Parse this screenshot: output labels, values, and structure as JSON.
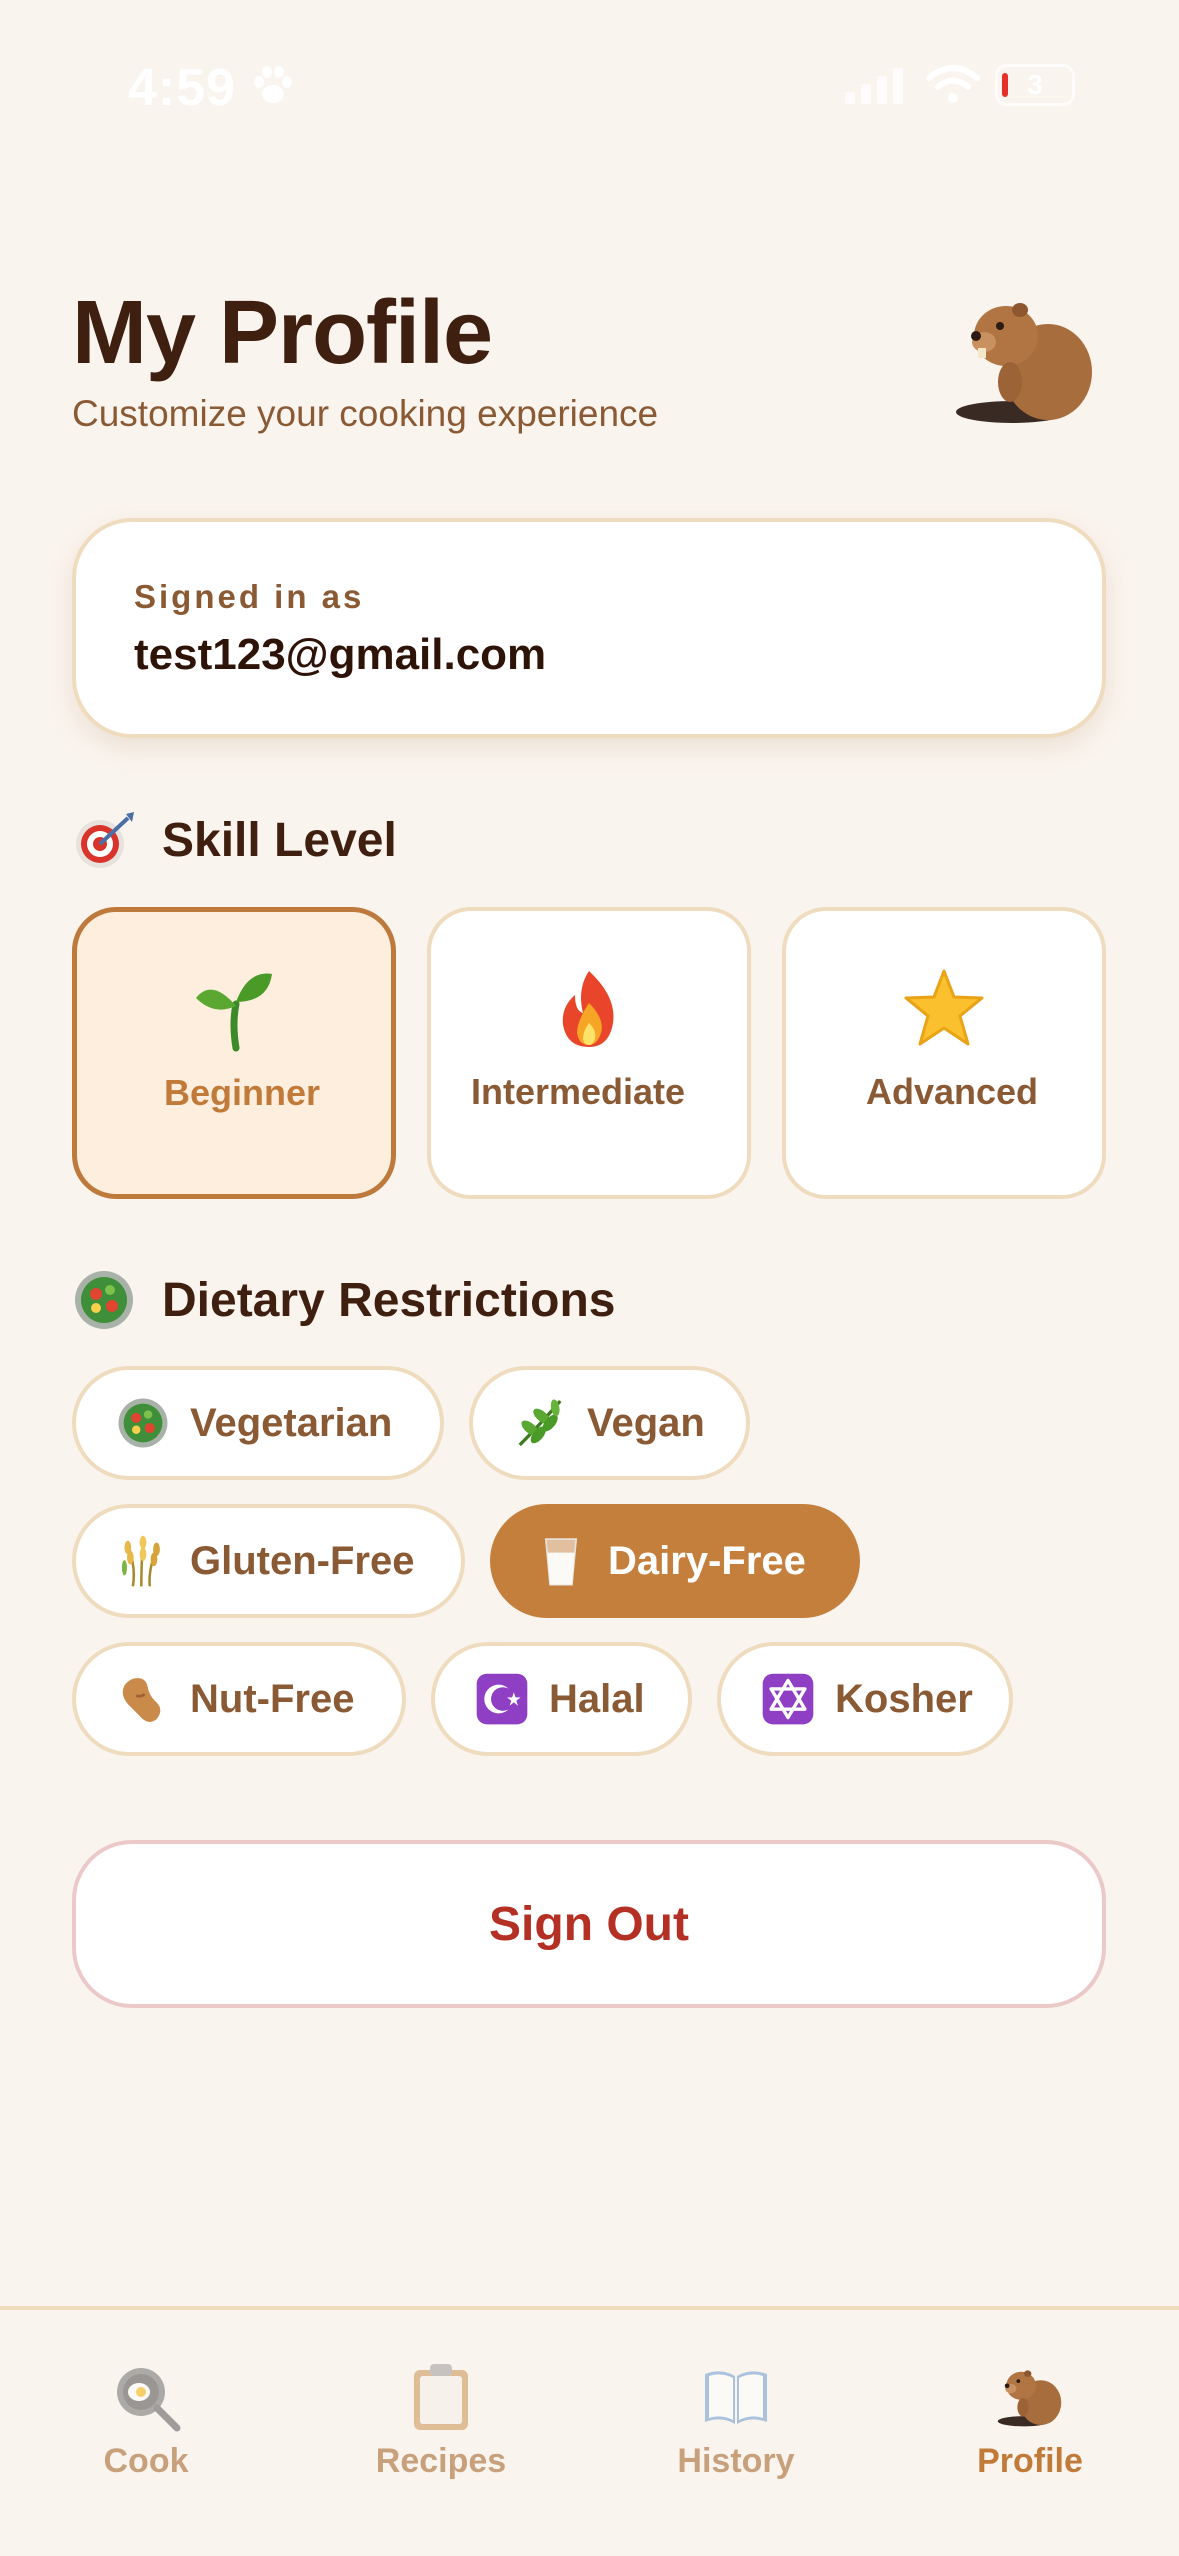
{
  "status_bar": {
    "time": "4:59",
    "battery": "3"
  },
  "header": {
    "title": "My Profile",
    "subtitle": "Customize your cooking experience",
    "avatar_icon": "beaver-icon"
  },
  "account": {
    "label": "Signed in as",
    "email": "test123@gmail.com"
  },
  "skill_level": {
    "heading": "Skill Level",
    "heading_icon": "target-icon",
    "options": [
      {
        "label": "Beginner",
        "icon": "seedling-icon",
        "selected": true
      },
      {
        "label": "Intermediate",
        "icon": "fire-icon",
        "selected": false
      },
      {
        "label": "Advanced",
        "icon": "star-icon",
        "selected": false
      }
    ]
  },
  "dietary": {
    "heading": "Dietary Restrictions",
    "heading_icon": "salad-icon",
    "options": [
      {
        "label": "Vegetarian",
        "icon": "salad-icon",
        "selected": false
      },
      {
        "label": "Vegan",
        "icon": "herb-icon",
        "selected": false
      },
      {
        "label": "Gluten-Free",
        "icon": "wheat-icon",
        "selected": false
      },
      {
        "label": "Dairy-Free",
        "icon": "milk-glass-icon",
        "selected": true
      },
      {
        "label": "Nut-Free",
        "icon": "peanut-icon",
        "selected": false
      },
      {
        "label": "Halal",
        "icon": "star-and-crescent-icon",
        "selected": false
      },
      {
        "label": "Kosher",
        "icon": "star-of-david-icon",
        "selected": false
      }
    ]
  },
  "sign_out": {
    "label": "Sign Out"
  },
  "tab_bar": {
    "items": [
      {
        "label": "Cook",
        "icon": "frying-pan-icon",
        "active": false
      },
      {
        "label": "Recipes",
        "icon": "clipboard-icon",
        "active": false
      },
      {
        "label": "History",
        "icon": "open-book-icon",
        "active": false
      },
      {
        "label": "Profile",
        "icon": "beaver-icon",
        "active": true
      }
    ]
  },
  "colors": {
    "background": "#faf4ee",
    "accent": "#c47f3c",
    "title": "#3e1f10",
    "secondary_text": "#8a5a35",
    "danger": "#b53024"
  }
}
